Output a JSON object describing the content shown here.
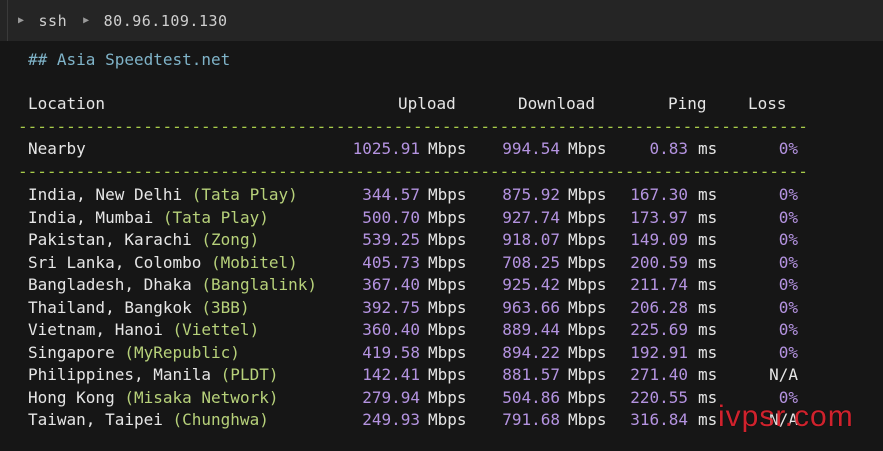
{
  "topbar": {
    "crumb1": "ssh",
    "crumb2": "80.96.109.130"
  },
  "terminal": {
    "heading": "## Asia Speedtest.net",
    "headers": {
      "location": "Location",
      "upload": "Upload",
      "download": "Download",
      "ping": "Ping",
      "loss": "Loss"
    },
    "divider": "----------------------------------------------------------------------------------",
    "nearby": {
      "location": "Nearby",
      "upload": "1025.91",
      "upload_unit": "Mbps",
      "download": "994.54",
      "download_unit": "Mbps",
      "ping": "0.83",
      "ping_unit": "ms",
      "loss": "0%"
    },
    "rows": [
      {
        "place": "India, New Delhi",
        "isp": "(Tata Play)",
        "upload": "344.57",
        "download": "875.92",
        "ping": "167.30",
        "loss": "0%"
      },
      {
        "place": "India, Mumbai",
        "isp": "(Tata Play)",
        "upload": "500.70",
        "download": "927.74",
        "ping": "173.97",
        "loss": "0%"
      },
      {
        "place": "Pakistan, Karachi",
        "isp": "(Zong)",
        "upload": "539.25",
        "download": "918.07",
        "ping": "149.09",
        "loss": "0%"
      },
      {
        "place": "Sri Lanka, Colombo",
        "isp": "(Mobitel)",
        "upload": "405.73",
        "download": "708.25",
        "ping": "200.59",
        "loss": "0%"
      },
      {
        "place": "Bangladesh, Dhaka",
        "isp": "(Banglalink)",
        "upload": "367.40",
        "download": "925.42",
        "ping": "211.74",
        "loss": "0%"
      },
      {
        "place": "Thailand, Bangkok",
        "isp": "(3BB)",
        "upload": "392.75",
        "download": "963.66",
        "ping": "206.28",
        "loss": "0%"
      },
      {
        "place": "Vietnam, Hanoi",
        "isp": "(Viettel)",
        "upload": "360.40",
        "download": "889.44",
        "ping": "225.69",
        "loss": "0%"
      },
      {
        "place": "Singapore",
        "isp": "(MyRepublic)",
        "upload": "419.58",
        "download": "894.22",
        "ping": "192.91",
        "loss": "0%"
      },
      {
        "place": "Philippines, Manila",
        "isp": "(PLDT)",
        "upload": "142.41",
        "download": "881.57",
        "ping": "271.40",
        "loss": "N/A"
      },
      {
        "place": "Hong Kong",
        "isp": "(Misaka Network)",
        "upload": "279.94",
        "download": "504.86",
        "ping": "220.55",
        "loss": "0%"
      },
      {
        "place": "Taiwan, Taipei",
        "isp": "(Chunghwa)",
        "upload": "249.93",
        "download": "791.68",
        "ping": "316.84",
        "loss": "N/A"
      }
    ],
    "units": {
      "speed": "Mbps",
      "ping": "ms"
    }
  },
  "watermark": "ivpsr.com",
  "colors": {
    "background": "#161616",
    "heading": "#7fb3c8",
    "divider": "#a8cc4a",
    "number": "#b493e0",
    "isp": "#b7d17a",
    "watermark": "#e0242f"
  }
}
